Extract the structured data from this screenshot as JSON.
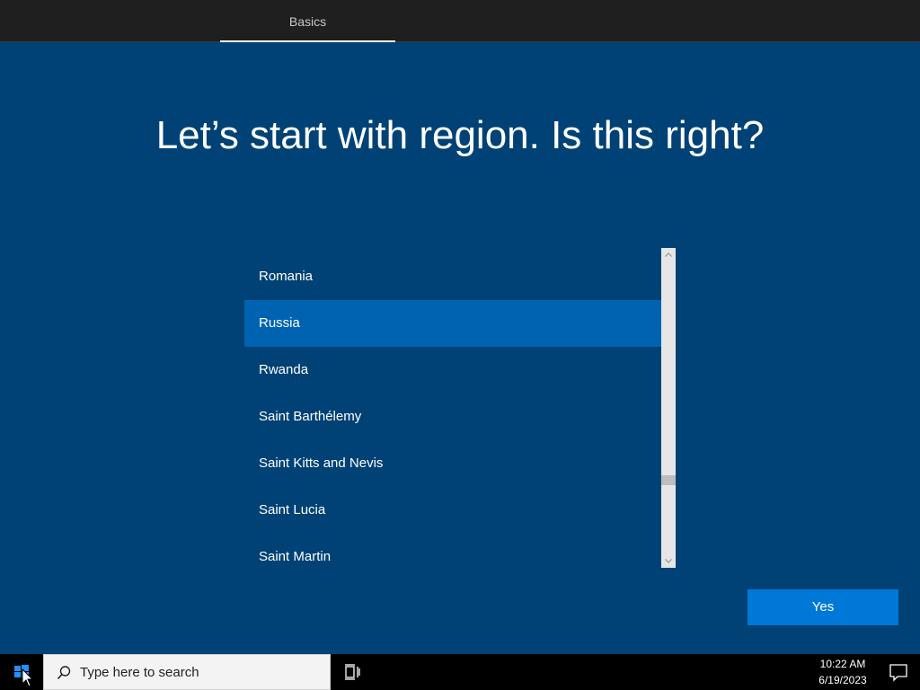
{
  "header": {
    "tab_label": "Basics"
  },
  "main": {
    "headline": "Let’s start with region. Is this right?",
    "regions": [
      "Romania",
      "Russia",
      "Rwanda",
      "Saint Barthélemy",
      "Saint Kitts and Nevis",
      "Saint Lucia",
      "Saint Martin"
    ],
    "selected_region": "Russia",
    "yes_label": "Yes"
  },
  "taskbar": {
    "search_placeholder": "Type here to search",
    "time": "10:22 AM",
    "date": "6/19/2023"
  },
  "icons": {
    "start": "windows-logo-icon",
    "search": "search-icon",
    "task_view": "task-view-icon",
    "notifications": "action-center-icon"
  },
  "colors": {
    "background": "#004275",
    "selected": "#0063b1",
    "button": "#0078d7",
    "topbar": "#1f1f1f",
    "taskbar": "#000000"
  }
}
